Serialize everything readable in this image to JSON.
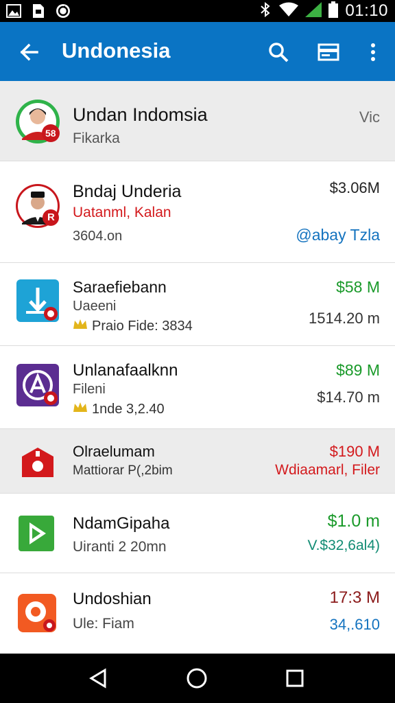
{
  "status_bar": {
    "time": "01:10",
    "icons": [
      "image-icon",
      "file-icon",
      "sync-icon",
      "bluetooth-icon",
      "wifi-icon",
      "signal-icon",
      "battery-icon"
    ]
  },
  "app_bar": {
    "title": "Undonesia",
    "color": "#0a74c4",
    "actions": [
      "search-icon",
      "card-icon",
      "more-vert-icon"
    ]
  },
  "rows": [
    {
      "name": "Undan Indomsia",
      "subtitle": "Fikarka",
      "right": "Vic",
      "avatar_icon": "person-avatar",
      "badge": "58"
    },
    {
      "name": "Bndaj Underia",
      "subtitle": "Uatanml, Kalan",
      "meta": "3604.on",
      "right_top": "$3.06M",
      "right_bottom": "@abay Tzla",
      "avatar_icon": "person-avatar",
      "badge": "R"
    },
    {
      "name": "Saraefiebann",
      "subtitle": "Uaeeni",
      "meta": "Praio Fide: 3834",
      "right_top": "$58 M",
      "right_bottom": "1514.20 m",
      "avatar_icon": "anchor-app-icon"
    },
    {
      "name": "Unlanafaalknn",
      "subtitle": "Fileni",
      "meta": "1nde 3,2.40",
      "right_top": "$89 M",
      "right_bottom": "$14.70 m",
      "avatar_icon": "a-app-icon"
    },
    {
      "name": "Olraelumam",
      "subtitle": "Mattiorar P(,2bim",
      "right_top": "$190 M",
      "right_bottom": "Wdiaamarl, Filer",
      "avatar_icon": "house-app-icon"
    },
    {
      "name": "NdamGipaha",
      "subtitle": "Uiranti 2 20mn",
      "right_top": "$1.0 m",
      "right_bottom": "V.$32,6al4)",
      "avatar_icon": "play-app-icon"
    },
    {
      "name": "Undoshian",
      "subtitle": "Ule: Fiam",
      "right_top": "17:3 M",
      "right_bottom": "34,.610",
      "avatar_icon": "circle-app-icon"
    }
  ],
  "colors": {
    "green": "#1a9a2a",
    "red": "#d3191c",
    "blue": "#1473bf",
    "teal": "#128c74",
    "darkred": "#8b1a1a"
  },
  "nav_bar": [
    "back-triangle-icon",
    "home-circle-icon",
    "recents-square-icon"
  ]
}
